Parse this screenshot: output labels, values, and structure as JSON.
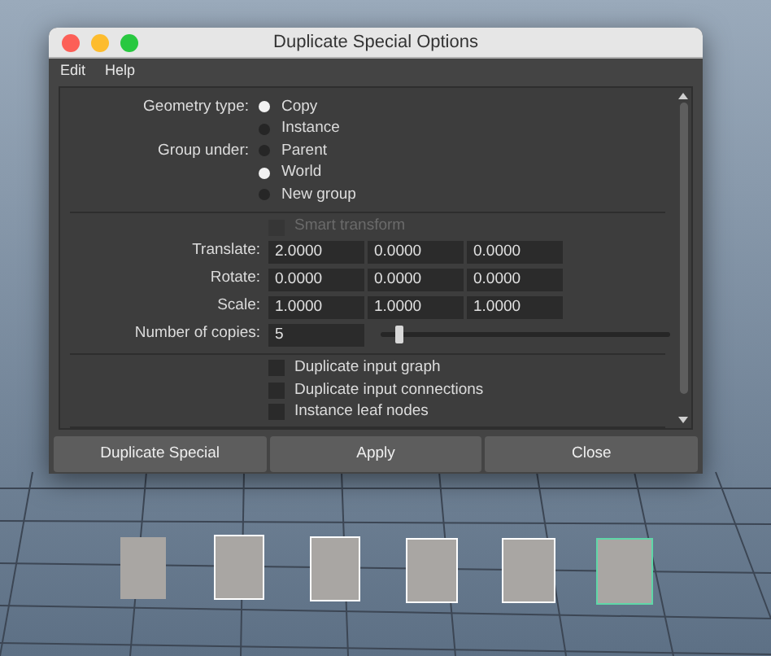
{
  "window": {
    "title": "Duplicate Special Options"
  },
  "menu": [
    "Edit",
    "Help"
  ],
  "geometry_type": {
    "label": "Geometry type:",
    "options": [
      {
        "label": "Copy",
        "selected": true
      },
      {
        "label": "Instance",
        "selected": false
      }
    ]
  },
  "group_under": {
    "label": "Group under:",
    "options": [
      {
        "label": "Parent",
        "selected": false
      },
      {
        "label": "World",
        "selected": true
      },
      {
        "label": "New group",
        "selected": false
      }
    ]
  },
  "smart_transform": {
    "label": "Smart transform",
    "checked": false,
    "disabled": true
  },
  "transform_rows": [
    {
      "label": "Translate:",
      "values": [
        "2.0000",
        "0.0000",
        "0.0000"
      ]
    },
    {
      "label": "Rotate:",
      "values": [
        "0.0000",
        "0.0000",
        "0.0000"
      ]
    },
    {
      "label": "Scale:",
      "values": [
        "1.0000",
        "1.0000",
        "1.0000"
      ]
    }
  ],
  "copies": {
    "label": "Number of copies:",
    "value": "5",
    "level": 0.05
  },
  "options": [
    {
      "label": "Duplicate input graph",
      "checked": false
    },
    {
      "label": "Duplicate input connections",
      "checked": false
    },
    {
      "label": "Instance leaf nodes",
      "checked": false
    }
  ],
  "buttons": [
    "Duplicate Special",
    "Apply",
    "Close"
  ]
}
